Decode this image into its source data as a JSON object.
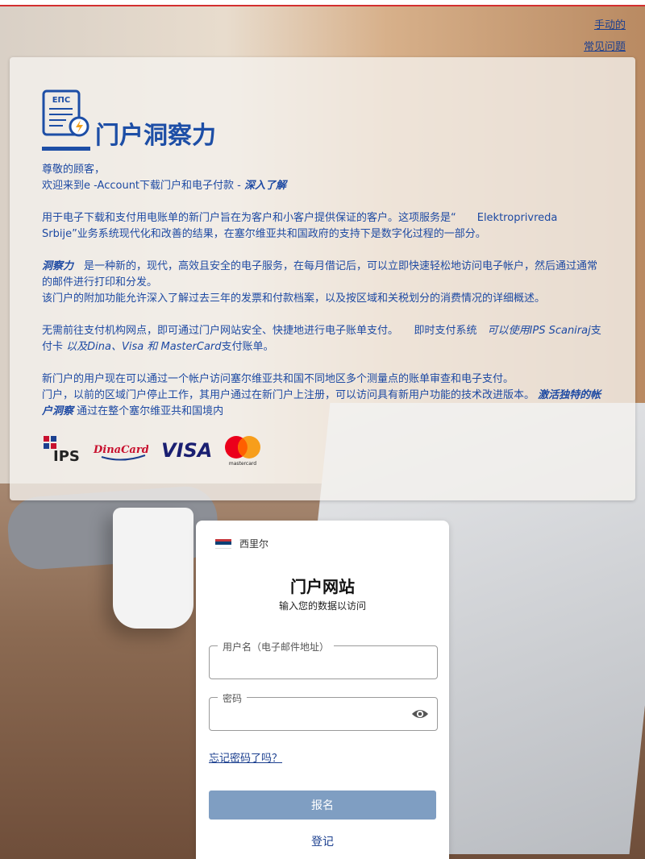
{
  "top_links": {
    "manual": "手动的",
    "faq": "常见问题"
  },
  "panel": {
    "brand": "门户洞察力",
    "greeting": "尊敬的顾客，",
    "welcome": "欢迎来到e -Account下载门户和电子付款 -",
    "welcome_link": "深入了解",
    "p1": "用于电子下载和支付用电账单的新门户旨在为客户和小客户提供保证的客户。这项服务是“　　Elektroprivreda Srbije”业务系统现代化和改善的结果，在塞尔维亚共和国政府的支持下是数字化过程的一部分。",
    "p2_em": "洞察力",
    "p2_a": "　是一种新的，现代，高效且安全的电子服务，在每月借记后，可以立即快速轻松地访问电子帐户，然后通过通常的邮件进行打印和分发。",
    "p2_b": "该门户的附加功能允许深入了解过去三年的发票和付款档案，以及按区域和关税划分的消费情况的详细概述。",
    "p3_a": "无需前往支付机构网点，即可通过门户网站安全、快捷地进行电子账单支付。　　即时支付系统　",
    "p3_i1": "可以使用IPS Scaniraj",
    "p3_b": "支付卡 ",
    "p3_i2": "以及Dina、Visa 和 MasterCard",
    "p3_c": "支付账单。",
    "p4_a": "新门户的用户现在可以通过一个帐户访问塞尔维亚共和国不同地区多个测量点的账单审查和电子支付。",
    "p4_b": "门户，以前的区域门户停止工作，其用户通过在新门户上注册，可以访问具有新用户功能的技术改进版本。 ",
    "p4_em": "激活独特的帐户洞察",
    "p4_c": "通过在整个塞尔维亚共和国境内",
    "logo_text": "ЕПС",
    "pay_ips": "IPS",
    "pay_dina": "DinaCard",
    "pay_visa": "VISA",
    "pay_mc": "mastercard"
  },
  "login": {
    "language": "西里尔",
    "title": "门户网站",
    "subtitle": "输入您的数据以访问",
    "username_label": "用户名（电子邮件地址）",
    "password_label": "密码",
    "forgot": "忘记密码了吗？",
    "submit": "报名",
    "register": "登记"
  },
  "colors": {
    "brand_blue": "#1d4ea6",
    "button": "#7f9ec2",
    "link": "#1b3f8f"
  }
}
